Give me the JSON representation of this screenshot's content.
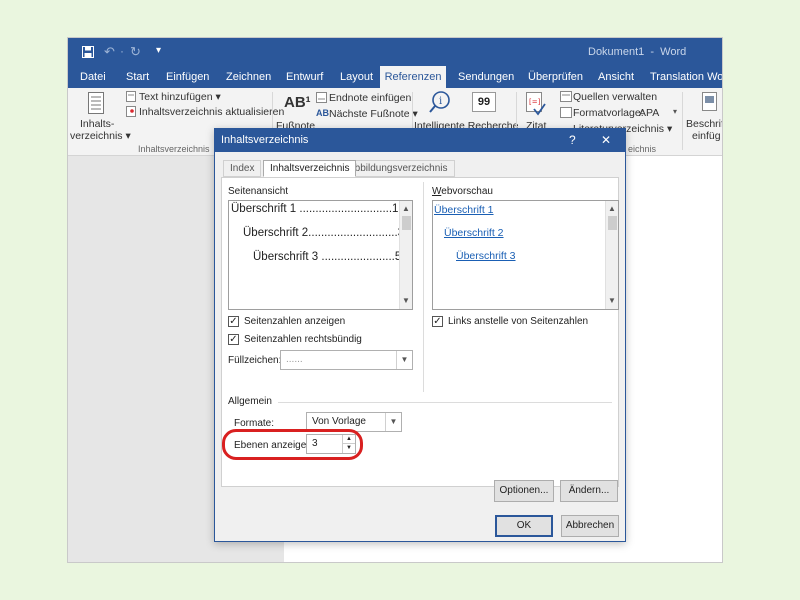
{
  "window": {
    "title": "Dokument1  -  Word",
    "qat_symbols": [
      "↶",
      "·",
      "↻",
      "▾"
    ]
  },
  "ribbon": {
    "tabs": [
      "Datei",
      "Start",
      "Einfügen",
      "Zeichnen",
      "Entwurf",
      "Layout",
      "Referenzen",
      "Sendungen",
      "Überprüfen",
      "Ansicht",
      "Translation Work"
    ],
    "active_tab": "Referenzen",
    "toc": {
      "big_button_line1": "Inhalts-",
      "big_button_line2": "verzeichnis ▾",
      "add_text": "Text hinzufügen ▾",
      "update_toc": "Inhaltsverzeichnis aktualisieren",
      "group_label": "Inhaltsverzeichnis"
    },
    "footnotes": {
      "insert_footnote_glyph": "AB¹",
      "insert_footnote": "Fußnote",
      "insert_endnote": "Endnote einfügen",
      "next_footnote_glyph": "AB",
      "next_footnote": "Nächste Fußnote ▾"
    },
    "research": {
      "smart_lookup": "Intelligente Recherche",
      "quote_glyph": "99",
      "citation": "Zitat"
    },
    "citations": {
      "manage_sources": "Quellen verwalten",
      "style_label": "Formatvorlage:",
      "style_value": "APA",
      "bibliography": "Literaturverzeichnis ▾",
      "group_label_fragment": "eichnis"
    },
    "captions": {
      "insert_caption_line1": "Beschrift",
      "insert_caption_line2": "einfüg"
    }
  },
  "dialog": {
    "title": "Inhaltsverzeichnis",
    "help": "?",
    "close": "✕",
    "tabs": [
      {
        "label": "Index",
        "active": false
      },
      {
        "label": "Inhaltsverzeichnis",
        "active": true
      },
      {
        "label": "Abbildungsverzeichnis",
        "active": false
      }
    ],
    "print_preview": {
      "label": "Seitenansicht",
      "lines": [
        "Überschrift 1 .............................1",
        "Überschrift 2............................3",
        "Überschrift 3 .......................5"
      ]
    },
    "web_preview": {
      "label": "Webvorschau",
      "links": [
        "Überschrift 1",
        "Überschrift 2",
        "Überschrift 3"
      ]
    },
    "show_page_numbers": {
      "label": "Seitenzahlen anzeigen",
      "checked": true
    },
    "right_align_page_numbers": {
      "label": "Seitenzahlen rechtsbündig",
      "checked": true
    },
    "tab_leader": {
      "label": "Füllzeichen:",
      "value": "......"
    },
    "use_hyperlinks": {
      "label": "Links anstelle von Seitenzahlen",
      "checked": true
    },
    "general": {
      "label": "Allgemein",
      "formats_label": "Formate:",
      "formats_value": "Von Vorlage",
      "levels_label": "Ebenen anzeigen:",
      "levels_value": "3"
    },
    "options_button": "Optionen...",
    "modify_button": "Ändern...",
    "ok_button": "OK",
    "cancel_button": "Abbrechen"
  },
  "colors": {
    "word_blue": "#2b579a",
    "highlight_red": "#d92020",
    "link_blue": "#1a5fb4"
  }
}
